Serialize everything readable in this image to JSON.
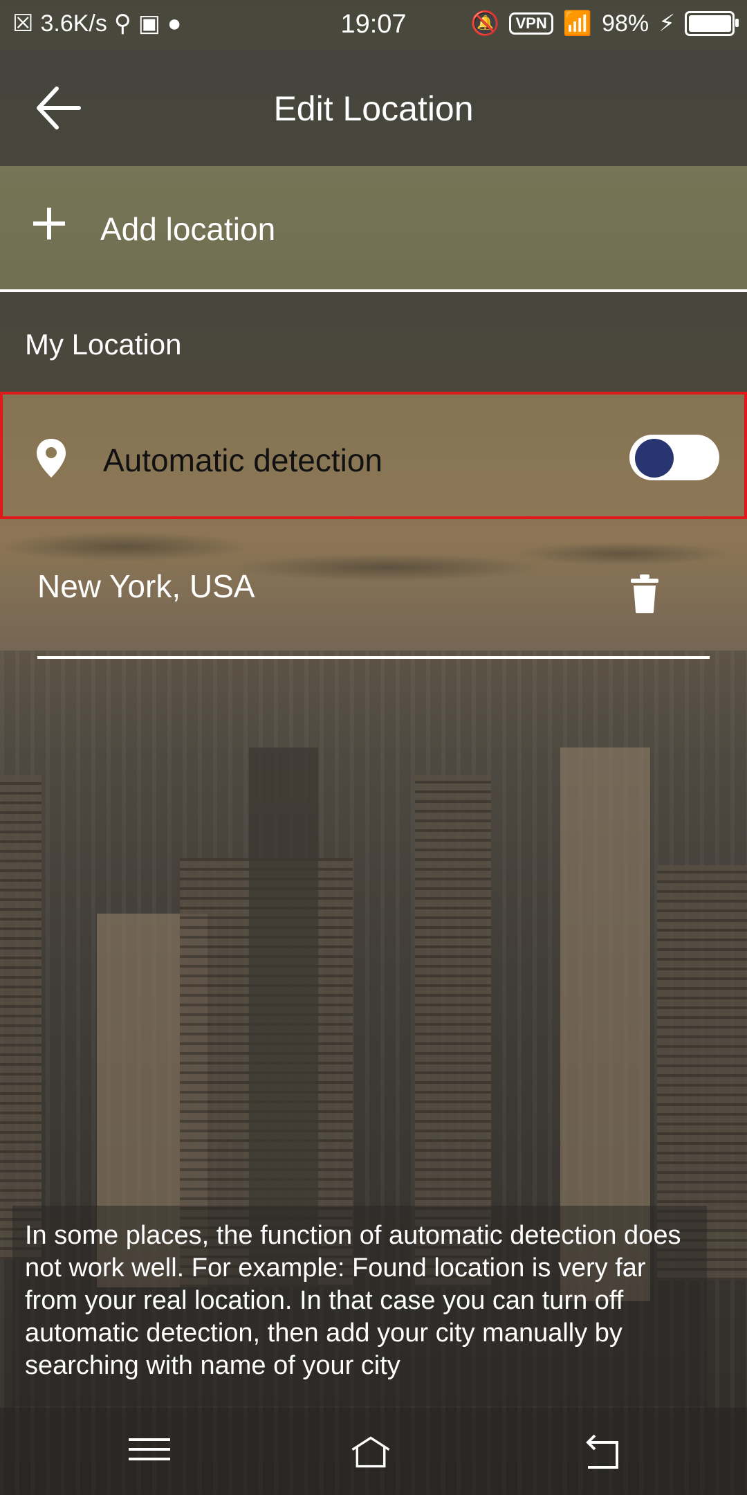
{
  "statusbar": {
    "network_speed": "3.6K/s",
    "time": "19:07",
    "vpn": "VPN",
    "battery": "98%"
  },
  "header": {
    "title": "Edit Location"
  },
  "add_location": {
    "label": "Add location"
  },
  "section": {
    "title": "My Location"
  },
  "automatic_detection": {
    "label": "Automatic detection",
    "enabled": true,
    "toggle_color": "#283570",
    "highlight_color": "#e0191b"
  },
  "locations": [
    {
      "name": "New York, USA"
    }
  ],
  "info": {
    "text": "In some places, the function of automatic detection does not work well. For example: Found location is very far from your real location. In that case you can turn off automatic detection, then add your city manually by searching with name of your city"
  },
  "icons": {
    "back": "arrow-left-icon",
    "add": "plus-icon",
    "location": "location-pin-icon",
    "delete": "trash-icon",
    "nav_menu": "menu-icon",
    "nav_home": "home-icon",
    "nav_back": "back-icon"
  }
}
